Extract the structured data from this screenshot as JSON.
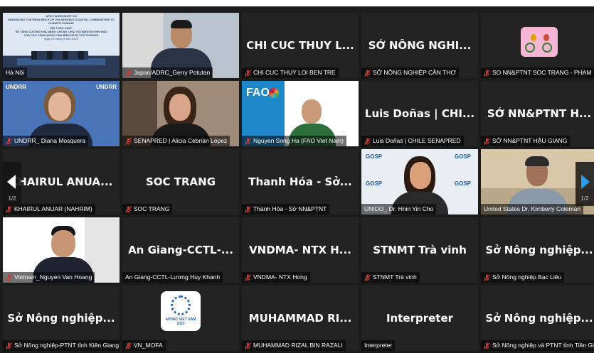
{
  "colors": {
    "grid_bg": "#1c1c1c",
    "tile_bg": "#232323",
    "active_speaker": "#3ad43a",
    "muted_icon": "#e0312f"
  },
  "tiles": [
    {
      "label": "Hà Nội",
      "display": "",
      "kind": "slide",
      "muted": false
    },
    {
      "label": "Japan/ADRC_Gerry Potutan",
      "display": "",
      "kind": "video-man-suit",
      "muted": true
    },
    {
      "label": "CHI CUC THUY LOI BEN TRE",
      "display": "CHI CUC THUY L...",
      "kind": "name",
      "muted": true
    },
    {
      "label": "SỞ NÔNG NGHIỆP CẦN THƠ",
      "display": "SỞ NÔNG NGHI...",
      "kind": "name",
      "muted": true
    },
    {
      "label": "SO NN&PTNT SOC TRANG - PHAM",
      "display": "",
      "kind": "avatar-bikes",
      "muted": true
    },
    {
      "label": "UNDRR_ Diana Mosquera",
      "display": "",
      "kind": "video-undrr",
      "muted": true
    },
    {
      "label": "SENAPRED | Alicia Cebrián López",
      "display": "",
      "kind": "video-woman",
      "muted": true
    },
    {
      "label": "Nguyen Song Ha (FAO Viet Nam)",
      "display": "",
      "kind": "video-fao",
      "muted": true
    },
    {
      "label": "Luis Doñas | CHILE SENAPRED",
      "display": "Luis Doñas | CHI...",
      "kind": "name",
      "muted": true
    },
    {
      "label": "SỞ NN&PTNT HẬU GIANG",
      "display": "SỞ NN&PTNT H...",
      "kind": "name",
      "muted": true
    },
    {
      "label": "KHAIRUL ANUAR (NAHRIM)",
      "display": "KHAIRUL ANUA...",
      "kind": "name",
      "muted": true
    },
    {
      "label": "SOC TRANG",
      "display": "SOC TRANG",
      "kind": "name",
      "muted": true
    },
    {
      "label": "Thanh Hóa - Sở NN&PTNT",
      "display": "Thanh Hóa - Sở...",
      "kind": "name",
      "muted": true
    },
    {
      "label": "UNIDO_ Dr. Hnin Yin Cho",
      "display": "",
      "kind": "video-gosp",
      "muted": false
    },
    {
      "label": "United States Dr. Kimberly Coleman",
      "display": "",
      "kind": "video-woman2",
      "muted": false,
      "speaker": true
    },
    {
      "label": "Vietnam_Nguyen Van Hoang",
      "display": "",
      "kind": "video-man",
      "muted": true
    },
    {
      "label": "An Giang-CCTL-Lương Huy Khanh",
      "display": "An Giang-CCTL-...",
      "kind": "name",
      "muted": false
    },
    {
      "label": "VNDMA- NTX Hong",
      "display": "VNDMA- NTX H...",
      "kind": "name",
      "muted": true
    },
    {
      "label": "STNMT Trà vinh",
      "display": "STNMT Trà vinh",
      "kind": "name",
      "muted": true
    },
    {
      "label": "Sở Nông nghiệp Bạc Liêu",
      "display": "Sở Nông nghiệp...",
      "kind": "name",
      "muted": true
    },
    {
      "label": "Sở Nông nghiệp-PTNT tỉnh Kiên Giang",
      "display": "Sở Nông nghiệp...",
      "kind": "name",
      "muted": true
    },
    {
      "label": "VN_MOFA",
      "display": "",
      "kind": "logo-apdrc",
      "muted": true
    },
    {
      "label": "MUHAMMAD RIZAL BIN RAZALI",
      "display": "MUHAMMAD RI...",
      "kind": "name",
      "muted": true
    },
    {
      "label": "Interpreter",
      "display": "Interpreter",
      "kind": "name",
      "muted": false
    },
    {
      "label": "Sở Nông nghiệp và PTNT tỉnh Tiền Gi",
      "display": "Sở Nông nghiệp...",
      "kind": "name",
      "muted": true
    }
  ],
  "pager": {
    "left_page": "1/2",
    "right_page": "1/2"
  },
  "slide": {
    "line1": "APEC WORKSHOP ON",
    "line2": "ENHANCING THE RESILIENCE OF VULNERABLE COASTAL COMMUNITIES TO CLIMATE CHANGE",
    "line3": "HỘI THẢO APEC",
    "line4": "VỀ TĂNG CƯỜNG KHẢ NĂNG CHỐNG CHỊU VỚI BIẾN ĐỔI KHÍ HẬU",
    "line5": "CỦA CÁC CỘNG ĐỒNG VEN BIỂN DỄ BỊ TỔN THƯƠNG",
    "line6": "ngày 21 tháng 3 năm 2023"
  },
  "undrr_text": "UNDRR",
  "fao_text": "FAO",
  "gosp_text": "GOSP",
  "apdrc_text": "APDRC VIET NAM 2023",
  "icons": {
    "mute": "mic-off-icon",
    "prev": "chevron-left-icon",
    "next": "chevron-right-icon"
  }
}
